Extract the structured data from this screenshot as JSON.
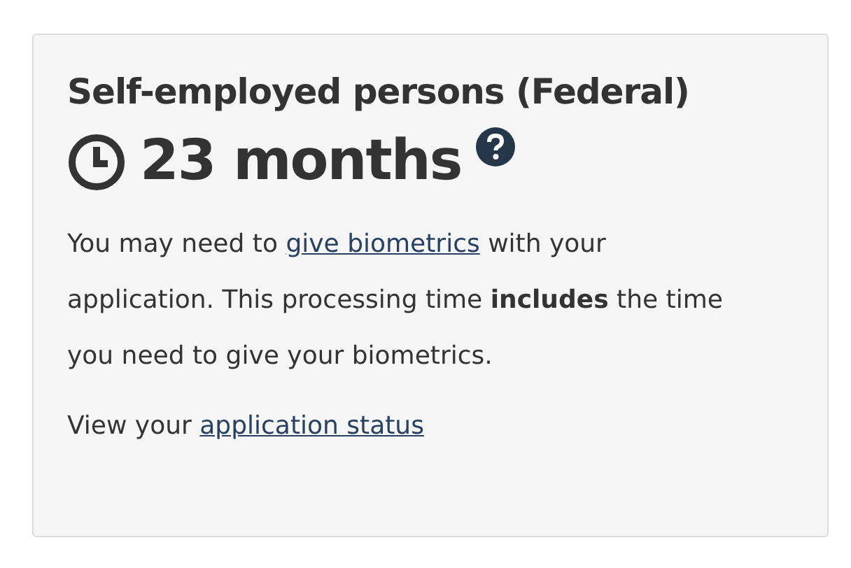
{
  "title": "Self-employed persons (Federal)",
  "duration": "23 months",
  "paragraphs": [
    {
      "before": "You may need to ",
      "link": "give biometrics",
      "after": " with your application. This processing time **includes** the time you need to give your biometrics."
    },
    {
      "before": "View your ",
      "link": "application status"
    }
  ]
}
